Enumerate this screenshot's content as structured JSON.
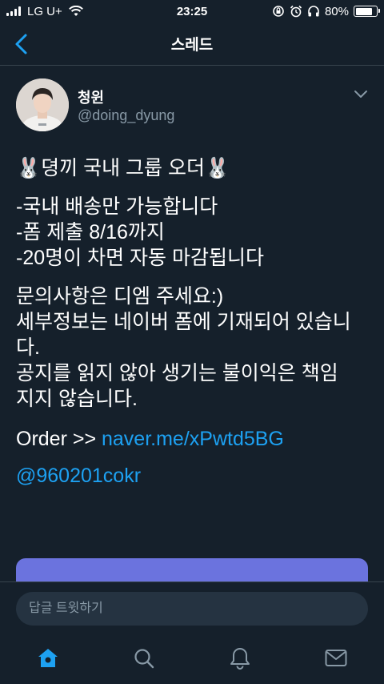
{
  "status_bar": {
    "carrier": "LG U+",
    "time": "23:25",
    "battery_percent": "80%",
    "battery_level": 0.8,
    "icons": [
      "signal-icon",
      "wifi-icon",
      "rotation-lock-icon",
      "alarm-icon",
      "headphones-icon",
      "battery-icon"
    ]
  },
  "nav": {
    "title": "스레드",
    "back_icon": "chevron-left-icon"
  },
  "tweet": {
    "author_name": "청윈",
    "author_handle": "@doing_dyung",
    "menu_icon": "chevron-down-icon",
    "lines_block1": [
      "🐰뎡끼 국내 그룹 오더🐰"
    ],
    "lines_block2": [
      "-국내 배송만 가능합니다",
      "-폼 제출 8/16까지",
      "-20명이 차면 자동 마감됩니다"
    ],
    "lines_block3": [
      "문의사항은 디엠 주세요:)",
      "세부정보는 네이버 폼에 기재되어 있습니",
      "다.",
      "공지를 읽지 않아 생기는 불이익은 책임",
      "지지 않습니다."
    ],
    "order_prefix": "Order >> ",
    "order_link": "naver.me/xPwtd5BG",
    "mention": "@960201cokr"
  },
  "reply": {
    "placeholder": "답글 트윗하기"
  },
  "tab_bar": {
    "tabs": [
      "home-icon",
      "search-icon",
      "notifications-icon",
      "messages-icon"
    ],
    "active_color": "#1da1f2",
    "inactive_color": "#8899a6"
  },
  "colors": {
    "background": "#15202b",
    "link": "#1da1f2",
    "secondary_text": "#8899a6",
    "card": "#6b73de"
  }
}
